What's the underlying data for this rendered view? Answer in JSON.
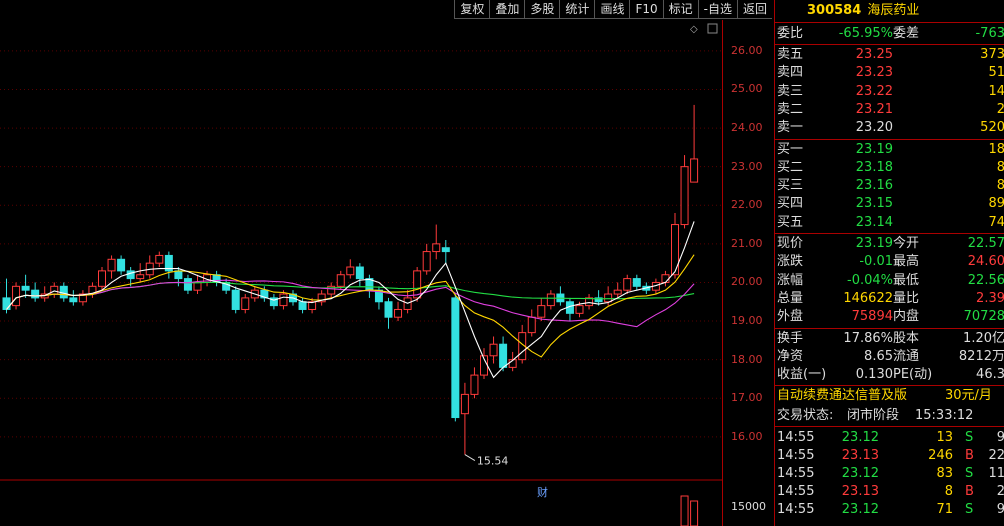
{
  "toolbar": {
    "buttons": [
      "复权",
      "叠加",
      "多股",
      "统计",
      "画线",
      "F10",
      "标记",
      "-自选",
      "返回"
    ]
  },
  "stock": {
    "code": "300584",
    "name": "海辰药业"
  },
  "quote": {
    "wb": {
      "label": "委比",
      "value": "-65.95%",
      "label2": "委差",
      "value2": "-763"
    },
    "asks": [
      {
        "label": "卖五",
        "price": "23.25",
        "vol": "373"
      },
      {
        "label": "卖四",
        "price": "23.23",
        "vol": "51"
      },
      {
        "label": "卖三",
        "price": "23.22",
        "vol": "14"
      },
      {
        "label": "卖二",
        "price": "23.21",
        "vol": "2"
      },
      {
        "label": "卖一",
        "price": "23.20",
        "vol": "520"
      }
    ],
    "bids": [
      {
        "label": "买一",
        "price": "23.19",
        "vol": "18"
      },
      {
        "label": "买二",
        "price": "23.18",
        "vol": "8"
      },
      {
        "label": "买三",
        "price": "23.16",
        "vol": "8"
      },
      {
        "label": "买四",
        "price": "23.15",
        "vol": "89"
      },
      {
        "label": "买五",
        "price": "23.14",
        "vol": "74"
      }
    ],
    "stats": [
      {
        "l1": "现价",
        "v1": "23.19",
        "l2": "今开",
        "v2": "22.57"
      },
      {
        "l1": "涨跌",
        "v1": "-0.01",
        "l2": "最高",
        "v2": "24.60"
      },
      {
        "l1": "涨幅",
        "v1": "-0.04%",
        "l2": "最低",
        "v2": "22.56"
      },
      {
        "l1": "总量",
        "v1": "146622",
        "l2": "量比",
        "v2": "2.39"
      },
      {
        "l1": "外盘",
        "v1": "75894",
        "l2": "内盘",
        "v2": "70728"
      }
    ],
    "stats2": [
      {
        "l1": "换手",
        "v1": "17.86%",
        "l2": "股本",
        "v2": "1.20亿"
      },
      {
        "l1": "净资",
        "v1": "8.65",
        "l2": "流通",
        "v2": "8212万"
      },
      {
        "l1": "收益(一)",
        "v1": "0.130",
        "l2": "PE(动)",
        "v2": "46.3"
      }
    ],
    "ad": {
      "text": "自动续费通达信普及版",
      "price": "30元/月"
    },
    "status": {
      "label": "交易状态:",
      "phase": "闭市阶段",
      "time": "15:33:12"
    },
    "ticks": [
      {
        "time": "14:55",
        "price": "23.12",
        "vol": "13",
        "side": "S",
        "num": "9"
      },
      {
        "time": "14:55",
        "price": "23.13",
        "vol": "246",
        "side": "B",
        "num": "22"
      },
      {
        "time": "14:55",
        "price": "23.12",
        "vol": "83",
        "side": "S",
        "num": "11"
      },
      {
        "time": "14:55",
        "price": "23.13",
        "vol": "8",
        "side": "B",
        "num": "2"
      },
      {
        "time": "14:55",
        "price": "23.12",
        "vol": "71",
        "side": "S",
        "num": "9"
      }
    ]
  },
  "chart": {
    "yticks": [
      "26.00",
      "25.00",
      "24.00",
      "23.00",
      "22.00",
      "21.00",
      "20.00",
      "19.00",
      "18.00",
      "17.00",
      "16.00"
    ],
    "low_label": "15.54",
    "cai": "财",
    "vol_tick": "15000",
    "colors": {
      "up": "#ff3b3b",
      "down": "#33e0e0",
      "ma5": "#ffffff",
      "ma10": "#ffd700",
      "ma20": "#e040e0",
      "ma60": "#22dd44"
    }
  },
  "chart_data": {
    "type": "candlestick",
    "price_range": [
      15.4,
      26.8
    ],
    "candles": [
      [
        19.6,
        19.3,
        20.1,
        19.2
      ],
      [
        19.4,
        19.9,
        20.0,
        19.3
      ],
      [
        19.9,
        19.8,
        20.2,
        19.6
      ],
      [
        19.8,
        19.6,
        20.0,
        19.5
      ],
      [
        19.6,
        19.7,
        19.9,
        19.5
      ],
      [
        19.7,
        19.9,
        20.0,
        19.6
      ],
      [
        19.9,
        19.6,
        20.0,
        19.5
      ],
      [
        19.6,
        19.5,
        19.8,
        19.4
      ],
      [
        19.5,
        19.7,
        19.8,
        19.4
      ],
      [
        19.7,
        19.9,
        20.0,
        19.6
      ],
      [
        19.9,
        20.3,
        20.4,
        19.8
      ],
      [
        20.3,
        20.6,
        20.7,
        20.1
      ],
      [
        20.6,
        20.3,
        20.7,
        20.2
      ],
      [
        20.3,
        20.1,
        20.4,
        19.9
      ],
      [
        20.1,
        20.2,
        20.5,
        20.0
      ],
      [
        20.2,
        20.5,
        20.7,
        20.1
      ],
      [
        20.5,
        20.7,
        20.8,
        20.4
      ],
      [
        20.7,
        20.3,
        20.8,
        20.1
      ],
      [
        20.3,
        20.1,
        20.4,
        19.9
      ],
      [
        20.1,
        19.8,
        20.2,
        19.7
      ],
      [
        19.8,
        20.0,
        20.2,
        19.7
      ],
      [
        20.0,
        20.2,
        20.3,
        19.9
      ],
      [
        20.2,
        20.0,
        20.3,
        19.9
      ],
      [
        20.0,
        19.8,
        20.1,
        19.7
      ],
      [
        19.8,
        19.3,
        19.9,
        19.2
      ],
      [
        19.3,
        19.6,
        19.7,
        19.2
      ],
      [
        19.6,
        19.8,
        19.9,
        19.5
      ],
      [
        19.8,
        19.6,
        19.9,
        19.5
      ],
      [
        19.6,
        19.4,
        19.7,
        19.3
      ],
      [
        19.4,
        19.7,
        19.8,
        19.3
      ],
      [
        19.7,
        19.5,
        19.8,
        19.4
      ],
      [
        19.5,
        19.3,
        19.6,
        19.2
      ],
      [
        19.3,
        19.5,
        19.6,
        19.2
      ],
      [
        19.5,
        19.7,
        19.8,
        19.4
      ],
      [
        19.7,
        19.9,
        20.0,
        19.6
      ],
      [
        19.9,
        20.2,
        20.3,
        19.8
      ],
      [
        20.2,
        20.4,
        20.6,
        20.1
      ],
      [
        20.4,
        20.1,
        20.5,
        19.9
      ],
      [
        20.1,
        19.8,
        20.2,
        19.6
      ],
      [
        19.8,
        19.5,
        19.9,
        19.3
      ],
      [
        19.5,
        19.1,
        19.6,
        18.8
      ],
      [
        19.1,
        19.3,
        19.5,
        19.0
      ],
      [
        19.3,
        19.6,
        19.8,
        19.2
      ],
      [
        19.6,
        20.3,
        20.4,
        19.5
      ],
      [
        20.3,
        20.8,
        21.0,
        20.2
      ],
      [
        20.8,
        21.0,
        21.5,
        20.6
      ],
      [
        20.9,
        20.8,
        21.1,
        20.5
      ],
      [
        19.6,
        16.5,
        19.7,
        16.4
      ],
      [
        16.6,
        17.1,
        17.4,
        15.54
      ],
      [
        17.1,
        17.6,
        17.8,
        17.0
      ],
      [
        17.6,
        18.1,
        18.3,
        17.5
      ],
      [
        18.1,
        18.4,
        18.6,
        17.9
      ],
      [
        18.4,
        17.8,
        18.6,
        17.7
      ],
      [
        17.8,
        18.0,
        18.2,
        17.7
      ],
      [
        18.0,
        18.7,
        18.9,
        17.9
      ],
      [
        18.7,
        19.1,
        19.3,
        18.6
      ],
      [
        19.1,
        19.4,
        19.6,
        19.0
      ],
      [
        19.4,
        19.7,
        19.8,
        19.3
      ],
      [
        19.7,
        19.5,
        19.9,
        19.4
      ],
      [
        19.5,
        19.2,
        19.6,
        19.0
      ],
      [
        19.2,
        19.4,
        19.5,
        19.1
      ],
      [
        19.4,
        19.6,
        19.7,
        19.3
      ],
      [
        19.6,
        19.5,
        19.8,
        19.4
      ],
      [
        19.5,
        19.7,
        19.9,
        19.4
      ],
      [
        19.7,
        19.8,
        20.0,
        19.6
      ],
      [
        19.8,
        20.1,
        20.2,
        19.7
      ],
      [
        20.1,
        19.9,
        20.2,
        19.8
      ],
      [
        19.9,
        19.8,
        20.0,
        19.7
      ],
      [
        19.8,
        20.0,
        20.1,
        19.7
      ],
      [
        20.0,
        20.2,
        20.3,
        19.9
      ],
      [
        20.2,
        21.5,
        21.8,
        20.1
      ],
      [
        21.5,
        23.0,
        23.3,
        21.4
      ],
      [
        22.6,
        23.2,
        24.6,
        22.6
      ]
    ]
  }
}
